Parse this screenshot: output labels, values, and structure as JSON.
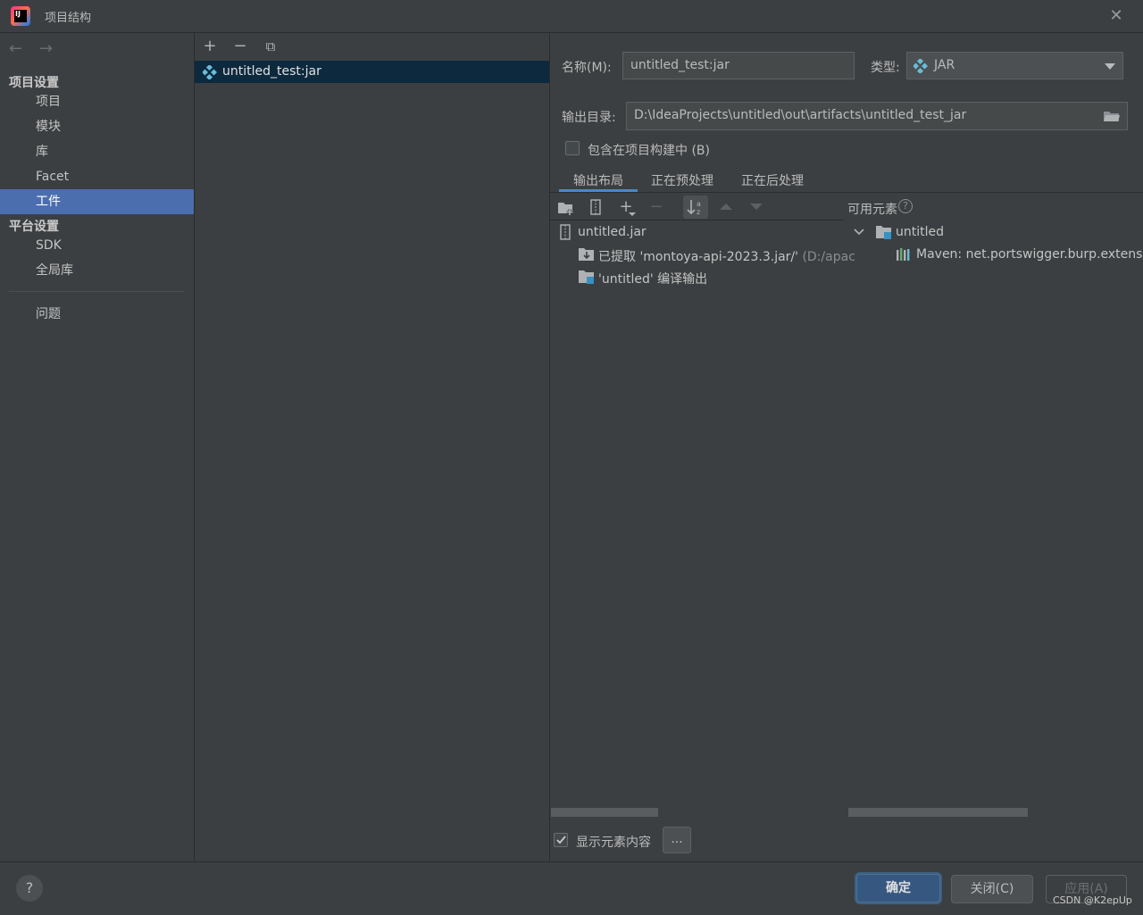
{
  "window": {
    "title": "项目结构"
  },
  "sidebar": {
    "project_settings_header": "项目设置",
    "project_items": [
      "项目",
      "模块",
      "库",
      "Facet",
      "工件"
    ],
    "selected": "工件",
    "platform_settings_header": "平台设置",
    "platform_items": [
      "SDK",
      "全局库"
    ],
    "problems": "问题"
  },
  "middle": {
    "toolbar": {
      "add": "+",
      "remove": "−",
      "copy": "⧉"
    },
    "artifact": "untitled_test:jar"
  },
  "form": {
    "name_label": "名称(M):",
    "name_value": "untitled_test:jar",
    "type_label": "类型:",
    "type_value": "JAR",
    "output_label": "输出目录:",
    "output_value": "D:\\IdeaProjects\\untitled\\out\\artifacts\\untitled_test_jar",
    "include_build_label": "包含在项目构建中 (B)"
  },
  "tabs": [
    "输出布局",
    "正在预处理",
    "正在后处理"
  ],
  "active_tab": "输出布局",
  "layout_tree": {
    "root": "untitled.jar",
    "extracted_label": "已提取 'montoya-api-2023.3.jar/'",
    "extracted_path": "(D:/apac",
    "compile_output": "'untitled' 编译输出"
  },
  "available": {
    "label": "可用元素",
    "root": "untitled",
    "child": "Maven: net.portswigger.burp.extensio"
  },
  "show_content_label": "显示元素内容",
  "show_content_checked": true,
  "ellipsis": "...",
  "footer": {
    "help": "?",
    "ok": "确定",
    "close": "关闭(C)",
    "apply": "应用(A)",
    "watermark": "CSDN @K2epUp"
  },
  "colors": {
    "accent": "#4b6eaf",
    "selection_dark": "#0d293e",
    "background": "#3c3f41"
  }
}
